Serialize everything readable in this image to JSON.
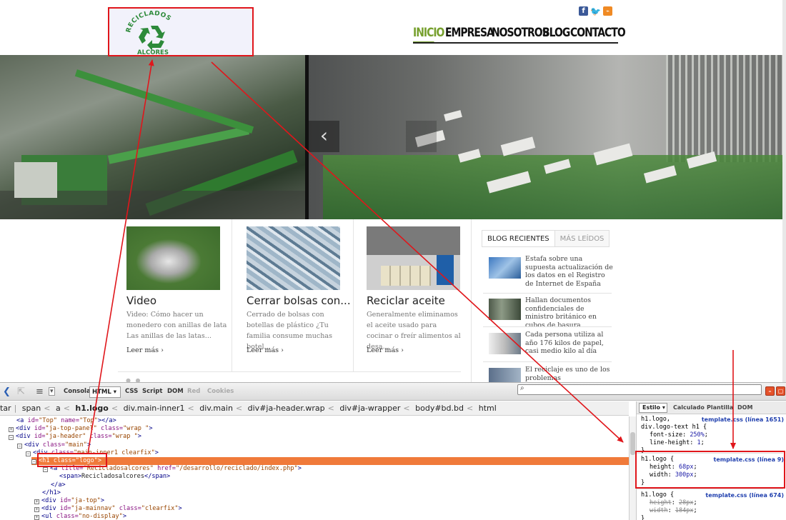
{
  "site": {
    "logo": {
      "top_text": "RECICLADOS",
      "bottom_text": "ALCORES"
    },
    "social": {
      "facebook": "f",
      "twitter": "🐦",
      "rss": "⌁"
    },
    "nav": [
      {
        "label": "INICIO",
        "active": true
      },
      {
        "label": "EMPRESA",
        "active": false
      },
      {
        "label": "NOSOTROS",
        "active": false
      },
      {
        "label": "BLOG",
        "active": false
      },
      {
        "label": "CONTACTO",
        "active": false
      }
    ],
    "slider": {
      "prev_glyph": "‹"
    },
    "articles": [
      {
        "title": "Video",
        "desc": "Video: Cómo hacer un monedero con anillas de lata Las anillas de las latas...",
        "more": "Leer más ›"
      },
      {
        "title": "Cerrar bolsas con...",
        "desc": "Cerrado de bolsas con botellas de plástico ¿Tu familia consume muchas botel...",
        "more": "Leer más ›"
      },
      {
        "title": "Reciclar aceite",
        "desc": "Generalmente eliminamos el aceite usado para cocinar o freír alimentos al desa...",
        "more": "Leer más ›"
      }
    ],
    "blog": {
      "tabs": [
        "BLOG RECIENTES",
        "MÁS LEÍDOS"
      ],
      "items": [
        "Estafa sobre una supuesta actualización de los datos en el Registro de Internet de España",
        "Hallan documentos confidenciales de ministro británico en cubos de basura",
        "Cada persona utiliza al año 176 kilos de papel, casi medio kilo al día",
        "El reciclaje es uno de los problemas medioambientales"
      ]
    }
  },
  "firebug": {
    "toolbar": {
      "tabs": [
        "Consola",
        "HTML ▾",
        "CSS",
        "Script",
        "DOM",
        "Red",
        "Cookies"
      ],
      "inspect_glyph": "⇱",
      "menu_glyph": "≡",
      "search_glyph": "⌕"
    },
    "breadcrumb": [
      "tar",
      "span",
      "a",
      "h1.logo",
      "div.main-inner1",
      "div.main",
      "div#ja-header.wrap",
      "div#ja-wrapper",
      "body#bd.bd",
      "html"
    ],
    "tree": [
      {
        "indent": 0,
        "pm": "",
        "html": "<span class='tg'>&lt;a</span> <span class='at'>id=</span><span class='av'>\"Top\"</span> <span class='at'>name=</span><span class='av'>\"Top\"</span><span class='tg'>&gt;&lt;/a&gt;</span>"
      },
      {
        "indent": 0,
        "pm": "+",
        "html": "<span class='tg'>&lt;div</span> <span class='at'>id=</span><span class='av'>\"ja-top-panel\"</span> <span class='at'>class=</span><span class='av'>\"wrap \"</span><span class='tg'>&gt;</span>"
      },
      {
        "indent": 0,
        "pm": "−",
        "html": "<span class='tg'>&lt;div</span> <span class='at'>id=</span><span class='av'>\"ja-header\"</span> <span class='at'>class=</span><span class='av'>\"wrap \"</span><span class='tg'>&gt;</span>"
      },
      {
        "indent": 1,
        "pm": "−",
        "html": "<span class='tg'>&lt;div</span> <span class='at'>class=</span><span class='av'>\"main\"</span><span class='tg'>&gt;</span>"
      },
      {
        "indent": 2,
        "pm": "−",
        "html": "<span class='tg'>&lt;div</span> <span class='at'>class=</span><span class='av'>\"main-inner1 clearfix\"</span><span class='tg'>&gt;</span>"
      },
      {
        "indent": 3,
        "pm": "−",
        "hl": true,
        "html": "<span class='tg'>&lt;h1</span> <span class='at'>class=</span><span class='av'>\"logo\"</span><span class='tg'>&gt;</span>"
      },
      {
        "indent": 4,
        "pm": "−",
        "html": "<span class='tg'>&lt;a</span> <span class='at'>title=</span><span class='av'>\"Recicladosalcores\"</span> <span class='at'>href=</span><span class='av'>\"/desarrollo/reciclado/index.php\"</span><span class='tg'>&gt;</span>"
      },
      {
        "indent": 5,
        "pm": "",
        "html": "<span class='tg'>&lt;span&gt;</span><span class='tx'>Recicladosalcores</span><span class='tg'>&lt;/span&gt;</span>"
      },
      {
        "indent": 4,
        "pm": "",
        "html": "<span class='tg'>&lt;/a&gt;</span>"
      },
      {
        "indent": 3,
        "pm": "",
        "html": "<span class='tg'>&lt;/h1&gt;</span>"
      },
      {
        "indent": 3,
        "pm": "+",
        "html": "<span class='tg'>&lt;div</span> <span class='at'>id=</span><span class='av'>\"ja-top\"</span><span class='tg'>&gt;</span>"
      },
      {
        "indent": 3,
        "pm": "+",
        "html": "<span class='tg'>&lt;div</span> <span class='at'>id=</span><span class='av'>\"ja-mainnav\"</span> <span class='at'>class=</span><span class='av'>\"clearfix\"</span><span class='tg'>&gt;</span>"
      },
      {
        "indent": 3,
        "pm": "+",
        "html": "<span class='tg'>&lt;ul</span> <span class='at'>class=</span><span class='av'>\"no-display\"</span><span class='tg'>&gt;</span>"
      }
    ],
    "side": {
      "tabs": [
        "Estilo ▾",
        "Calculado",
        "Plantilla",
        "DOM"
      ],
      "rules": [
        {
          "selector": "h1.logo,\ndiv.logo-text h1 {",
          "source": "template.css (línea 1651)",
          "props": [
            [
              "font-size",
              "250%"
            ],
            [
              "line-height",
              "1"
            ]
          ],
          "strike": false
        },
        {
          "selector": "h1.logo {",
          "source": "template.css (línea 9)",
          "props": [
            [
              "height",
              "68px"
            ],
            [
              "width",
              "300px"
            ]
          ],
          "strike": false
        },
        {
          "selector": "h1.logo {",
          "source": "template.css (línea 674)",
          "props": [
            [
              "height",
              "28px"
            ],
            [
              "width",
              "184px"
            ]
          ],
          "strike": true
        }
      ]
    }
  },
  "colors": {
    "nav_active": "#77a02e",
    "annotation": "#e0161b",
    "highlight_row": "#f07a3a"
  }
}
